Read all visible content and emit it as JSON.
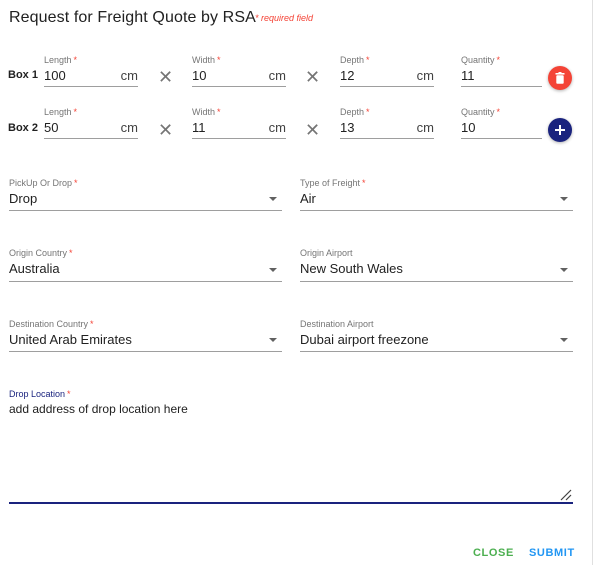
{
  "dialog": {
    "title": "Request for Freight Quote by RSA",
    "required_note": "* required field"
  },
  "boxes": [
    {
      "label": "Box 1",
      "length": "100",
      "width": "10",
      "depth": "12",
      "quantity": "11",
      "action": "delete-icon"
    },
    {
      "label": "Box 2",
      "length": "50",
      "width": "11",
      "depth": "13",
      "quantity": "10",
      "action": "add-icon"
    }
  ],
  "box_fields": {
    "length": "Length",
    "width": "Width",
    "depth": "Depth",
    "quantity": "Quantity",
    "unit": "cm",
    "required_mark": "*",
    "times": "✕"
  },
  "selects": {
    "pickup_drop": {
      "label": "PickUp Or Drop",
      "value": "Drop",
      "required": "*"
    },
    "freight_type": {
      "label": "Type of Freight",
      "value": "Air",
      "required": "*"
    },
    "origin_country": {
      "label": "Origin Country",
      "value": "Australia",
      "required": "*"
    },
    "origin_airport": {
      "label": "Origin Airport",
      "value": "New South Wales"
    },
    "destination_country": {
      "label": "Destination Country",
      "value": "United Arab Emirates",
      "required": "*"
    },
    "destination_airport": {
      "label": "Destination Airport",
      "value": "Dubai airport freezone"
    }
  },
  "drop_location": {
    "label": "Drop Location",
    "required": "*",
    "value": "add address of drop location here"
  },
  "actions": {
    "close": "CLOSE",
    "submit": "SUBMIT"
  },
  "colors": {
    "required": "#f44336",
    "accent": "#1a237e",
    "delete": "#f44336",
    "close": "#4caf50",
    "submit": "#2196f3"
  }
}
